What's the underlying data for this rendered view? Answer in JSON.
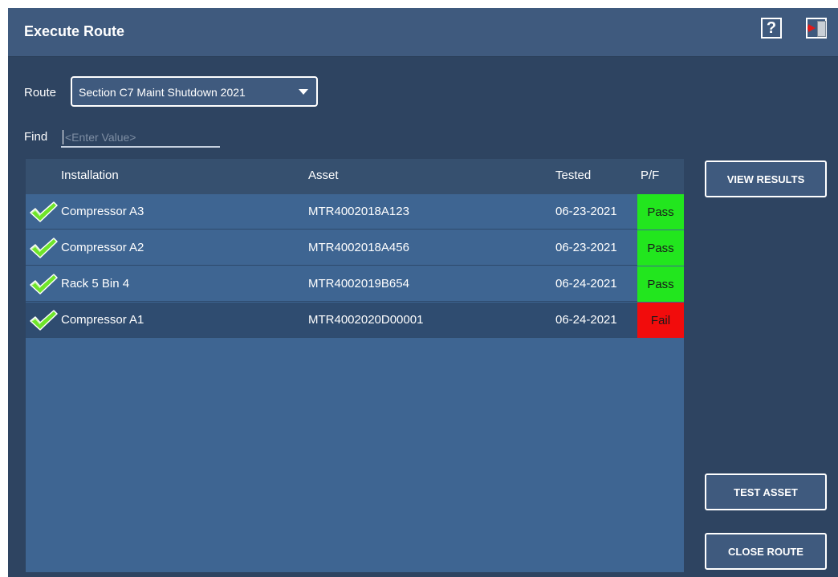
{
  "header": {
    "title": "Execute Route",
    "help_label": "?",
    "help_icon": "help-icon",
    "exit_icon": "exit-door-icon"
  },
  "route": {
    "label": "Route",
    "selected": "Section C7 Maint Shutdown 2021"
  },
  "find": {
    "label": "Find",
    "placeholder": "<Enter Value>"
  },
  "table": {
    "columns": [
      "Installation",
      "Asset",
      "Tested",
      "P/F"
    ],
    "rows": [
      {
        "installation": "Compressor A3",
        "asset": "MTR4002018A123",
        "tested": "06-23-2021",
        "result": "Pass",
        "selected": false
      },
      {
        "installation": "Compressor A2",
        "asset": "MTR4002018A456",
        "tested": "06-23-2021",
        "result": "Pass",
        "selected": false
      },
      {
        "installation": "Rack 5 Bin 4",
        "asset": "MTR4002019B654",
        "tested": "06-24-2021",
        "result": "Pass",
        "selected": false
      },
      {
        "installation": "Compressor A1",
        "asset": "MTR4002020D00001",
        "tested": "06-24-2021",
        "result": "Fail",
        "selected": true
      }
    ]
  },
  "buttons": {
    "view_results": "VIEW RESULTS",
    "test_asset": "TEST ASSET",
    "close_route": "CLOSE ROUTE"
  },
  "colors": {
    "pass": "#22e61e",
    "fail": "#f20c0c",
    "check": "#6fe52a"
  }
}
